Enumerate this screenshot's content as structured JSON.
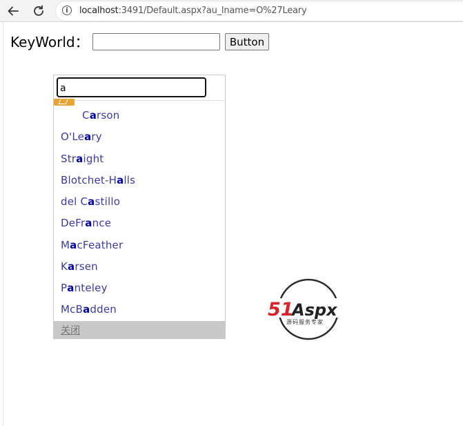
{
  "browser": {
    "url_host": "localhost",
    "url_path": ":3491/Default.aspx?au_lname=O%27Leary"
  },
  "form": {
    "label": "KeyWorld：",
    "keyword_value": "",
    "button_label": "Button"
  },
  "autocomplete": {
    "query": "a",
    "items": [
      {
        "pre": "C",
        "match": "a",
        "post": "rson"
      },
      {
        "pre": "O'Le",
        "match": "a",
        "post": "ry"
      },
      {
        "pre": "Str",
        "match": "a",
        "post": "ight"
      },
      {
        "pre": "Blotchet-H",
        "match": "a",
        "post": "lls"
      },
      {
        "pre": "del C",
        "match": "a",
        "post": "stillo"
      },
      {
        "pre": "DeFr",
        "match": "a",
        "post": "nce"
      },
      {
        "pre": "M",
        "match": "a",
        "post": "cFeather"
      },
      {
        "pre": "K",
        "match": "a",
        "post": "rsen"
      },
      {
        "pre": "P",
        "match": "a",
        "post": "nteley"
      },
      {
        "pre": "McB",
        "match": "a",
        "post": "dden"
      }
    ],
    "close_label": "关闭"
  },
  "logo": {
    "brand_num": "51",
    "brand_text": "Aspx",
    "tagline": "源码服务专家"
  },
  "icons": {
    "back": "back-arrow-icon",
    "reload": "reload-icon",
    "info": "info-icon"
  }
}
